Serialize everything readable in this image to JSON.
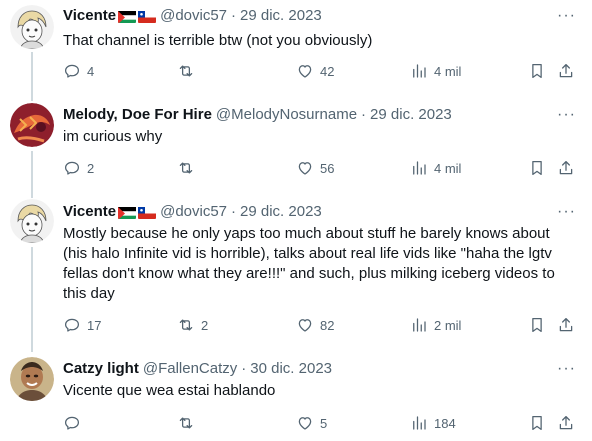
{
  "tweets": [
    {
      "name": "Vicente",
      "handle": "@dovic57",
      "date": "29 dic. 2023",
      "text": "That channel is terrible btw (not you obviously)",
      "replies": "4",
      "reposts": "",
      "likes": "42",
      "views": "4 mil"
    },
    {
      "name": "Melody, Doe For Hire",
      "handle": "@MelodyNosurname",
      "date": "29 dic. 2023",
      "text": "im curious why",
      "replies": "2",
      "reposts": "",
      "likes": "56",
      "views": "4 mil"
    },
    {
      "name": "Vicente",
      "handle": "@dovic57",
      "date": "29 dic. 2023",
      "text": "Mostly because he only yaps too much about stuff he barely knows about (his halo Infinite vid is horrible), talks about real life vids like \"haha the lgtv fellas don't know what they are!!!\" and such, plus milking iceberg videos to this day",
      "replies": "17",
      "reposts": "2",
      "likes": "82",
      "views": "2 mil"
    },
    {
      "name": "Catzy light",
      "handle": "@FallenCatzy",
      "date": "30 dic. 2023",
      "text": "Vicente que wea estai hablando",
      "replies": "",
      "reposts": "",
      "likes": "5",
      "views": "184"
    }
  ],
  "ui": {
    "dot": "·",
    "more": "···"
  },
  "icons": [
    "reply-icon",
    "repost-icon",
    "like-icon",
    "views-icon",
    "bookmark-icon",
    "share-icon",
    "more-icon"
  ],
  "colors": {
    "text": "#0f1419",
    "secondary": "#536471",
    "thread_line": "#cfd9de"
  }
}
